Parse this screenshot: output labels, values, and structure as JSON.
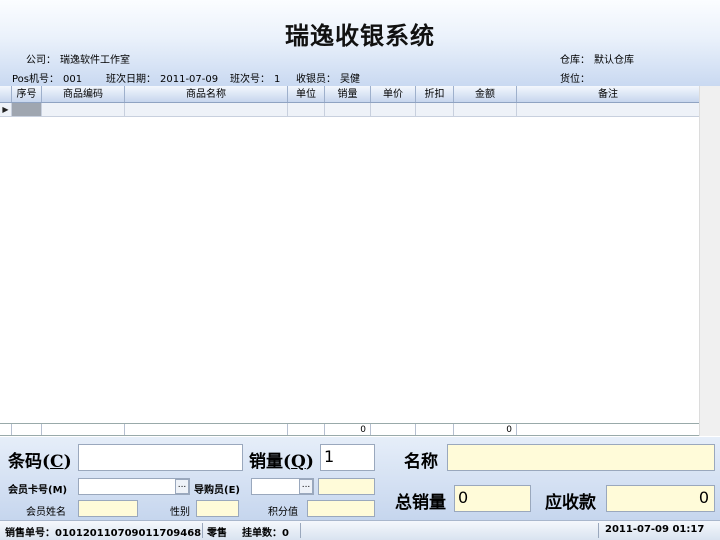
{
  "app": {
    "title": "瑞逸收银系统"
  },
  "header": {
    "company_label": "公司：",
    "company_value": "瑞逸软件工作室",
    "warehouse_label": "仓库：",
    "warehouse_value": "默认仓库",
    "pos_label": "Pos机号：",
    "pos_value": "001",
    "shift_date_label": "班次日期：",
    "shift_date_value": "2011-07-09",
    "shift_no_label": "班次号：",
    "shift_no_value": "1",
    "cashier_label": "收银员：",
    "cashier_value": "吴健",
    "location_label": "货位：",
    "location_value": ""
  },
  "grid": {
    "columns": [
      "序号",
      "商品编码",
      "商品名称",
      "单位",
      "销量",
      "单价",
      "折扣",
      "金额",
      "备注"
    ],
    "totals": {
      "qty": "0",
      "amount": "0"
    }
  },
  "panel": {
    "barcode_label": "条码(",
    "barcode_key": "C",
    "barcode_close": ")",
    "barcode_value": "",
    "qty_label": "销量(",
    "qty_key": "Q",
    "qty_close": ")",
    "qty_value": "1",
    "name_label": "名称",
    "name_value": "",
    "member_card_label": "会员卡号(M)",
    "member_card_value": "",
    "guide_label": "导购员(E)",
    "guide_value": "",
    "member_name_label": "会员姓名",
    "member_name_value": "",
    "gender_label": "性别",
    "gender_value": "",
    "points_label": "积分值",
    "points_value": "",
    "total_qty_label": "总销量",
    "total_qty_value": "0",
    "receivable_label": "应收款",
    "receivable_value": "0",
    "ellipsis": "..."
  },
  "status": {
    "order_label": "销售单号：",
    "order_value": "010120110709011709468",
    "mode": "零售",
    "hold_label": "挂单数：",
    "hold_value": "0",
    "datetime": "2011-07-09  01:17"
  }
}
